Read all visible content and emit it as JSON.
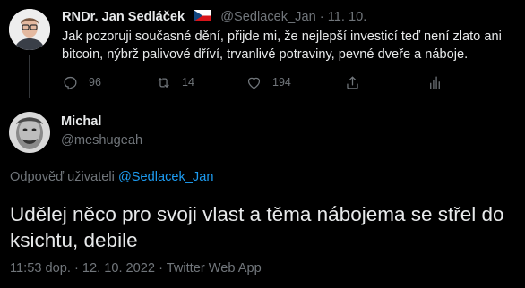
{
  "colors": {
    "background": "#000000",
    "text": "#e7e9ea",
    "muted": "#71767b",
    "link": "#1d9bf0"
  },
  "parent_tweet": {
    "name": "RNDr. Jan Sedláček",
    "flag_icon": "czech-flag-icon",
    "handle": "@Sedlacek_Jan",
    "separator": "·",
    "date": "11. 10.",
    "text": "Jak pozoruji současné dění, přijde mi, že nejlepší investicí teď není zlato ani bitcoin, nýbrž palivové dříví, trvanlivé potraviny, pevné dveře a náboje.",
    "actions": {
      "reply_count": "96",
      "retweet_count": "14",
      "like_count": "194"
    }
  },
  "reply_tweet": {
    "name": "Michal",
    "handle": "@meshugeah",
    "replying_to_label": "Odpověď uživateli",
    "replying_to_handle": "@Sedlacek_Jan",
    "text": "Udělej něco pro svoji vlast a těma nábojema se střel do ksichtu, debile",
    "timestamp": "11:53 dop. · 12. 10. 2022 · Twitter Web App"
  }
}
